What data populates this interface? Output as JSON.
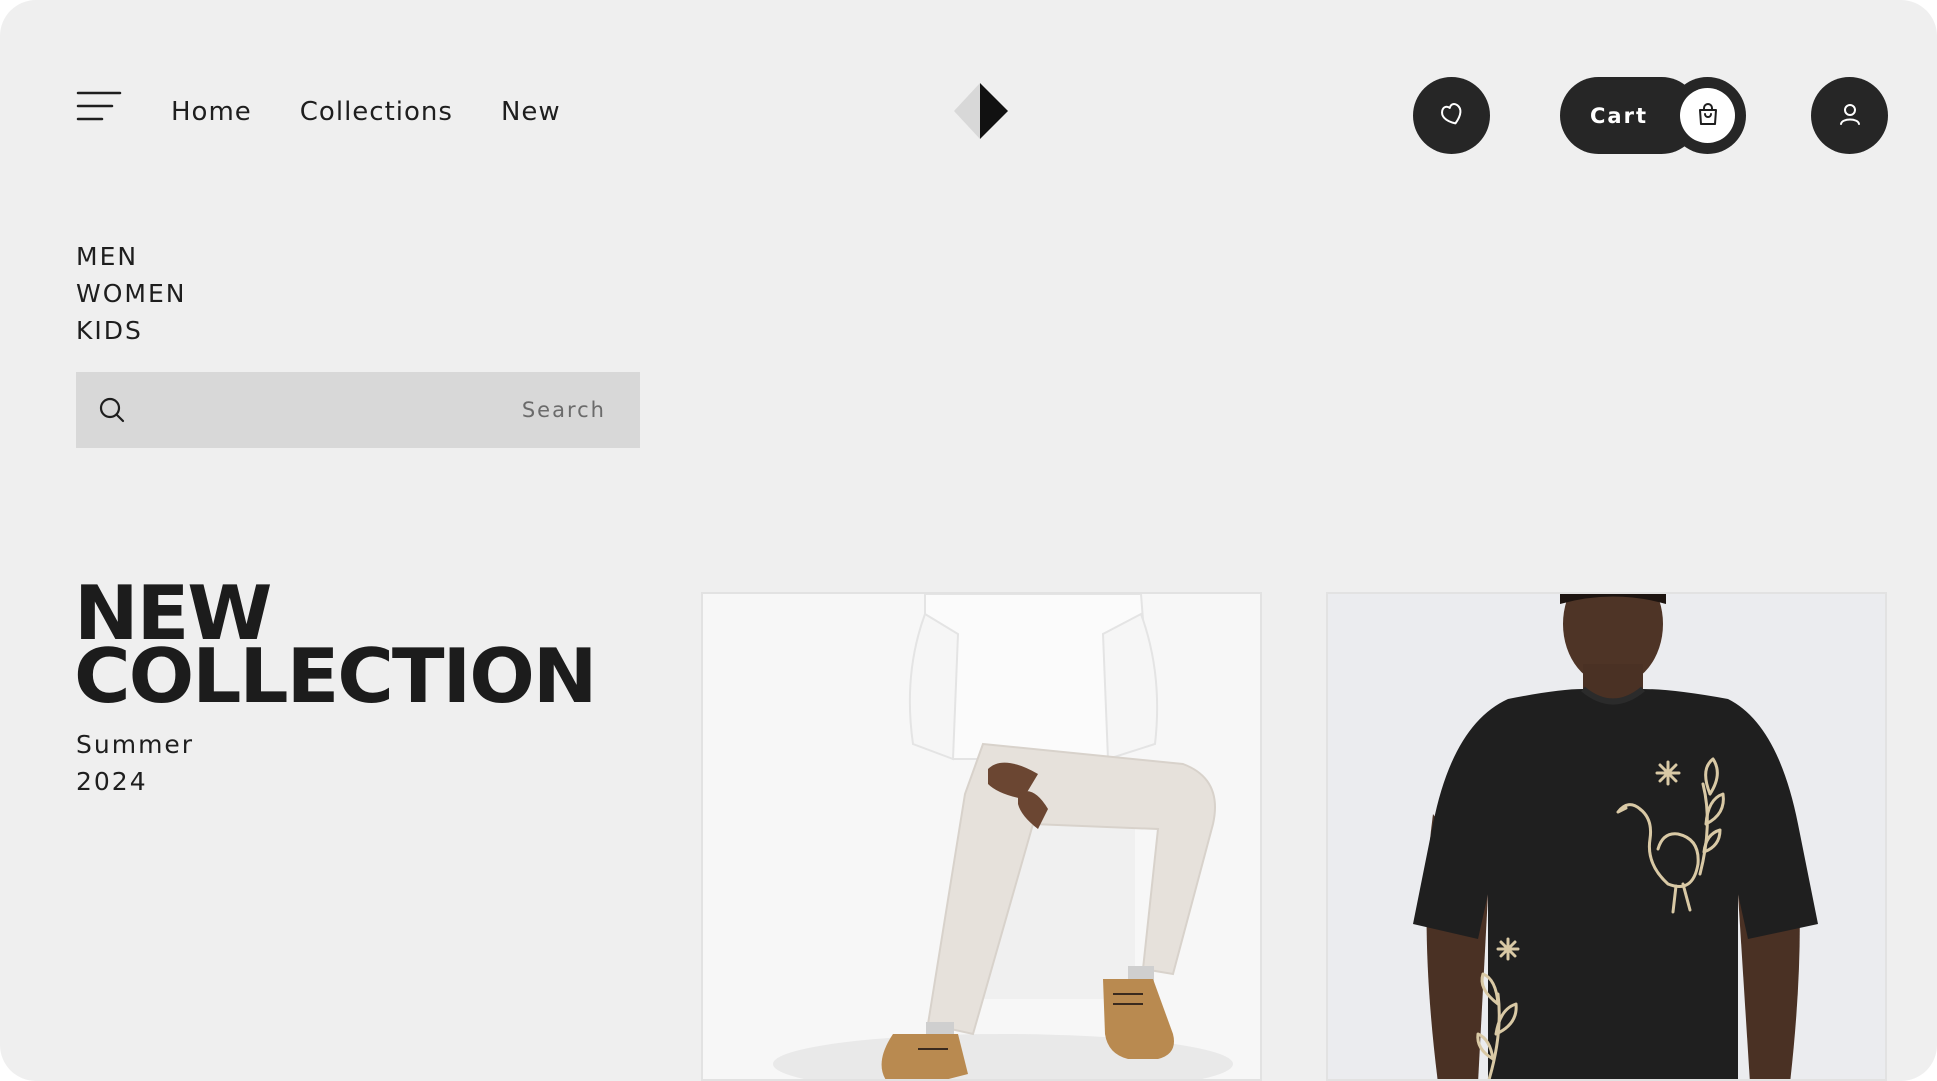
{
  "header": {
    "menu_icon": "hamburger-menu-icon",
    "nav": [
      "Home",
      "Collections",
      "New"
    ],
    "logo_icon": "diamond-play-logo",
    "favorites_icon": "heart-icon",
    "cart_label": "Cart",
    "cart_icon": "shopping-bag-icon",
    "profile_icon": "user-icon"
  },
  "categories": [
    "MEN",
    "WOMEN",
    "KIDS"
  ],
  "search": {
    "placeholder": "Search",
    "icon": "search-icon"
  },
  "hero": {
    "title_line1": "NEW",
    "title_line2": "COLLECTION",
    "subtitle_line1": "Summer",
    "subtitle_line2": "2024"
  },
  "products": [
    {
      "image": "model-white-sweater-beige-trousers-boots"
    },
    {
      "image": "model-black-embroidered-tshirt"
    }
  ],
  "colors": {
    "background": "#efefef",
    "dark_button": "#262626",
    "search_bg": "#d8d8d8",
    "text": "#1e1e1e"
  }
}
